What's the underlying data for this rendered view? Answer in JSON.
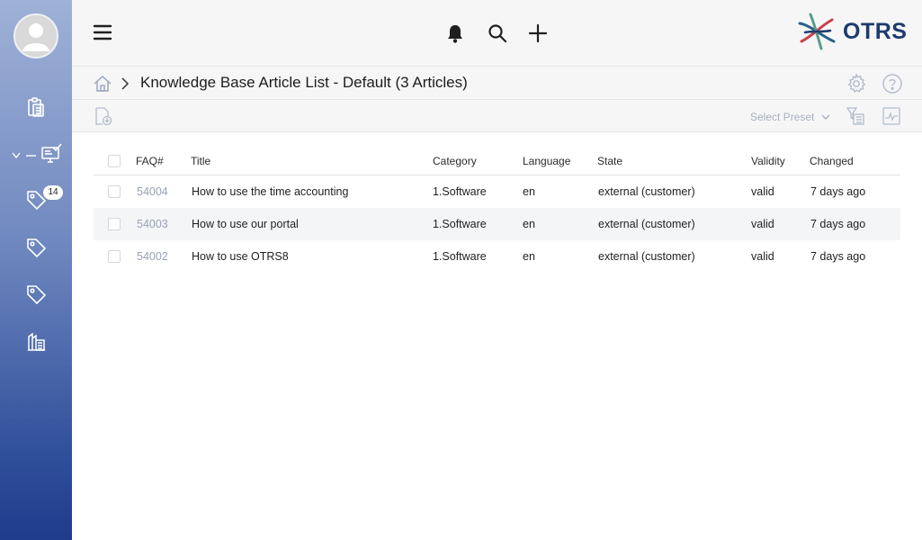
{
  "brand": {
    "name": "OTRS",
    "accent": "#1f3b8c"
  },
  "sidebar": {
    "items": [
      {
        "icon": "clipboard-icon"
      },
      {
        "icon": "agent-dashboard-icon"
      },
      {
        "icon": "tag-icon",
        "badge": "14"
      },
      {
        "icon": "tag-icon"
      },
      {
        "icon": "tag-icon"
      },
      {
        "icon": "reports-icon"
      }
    ]
  },
  "topbar": {
    "icons": [
      "menu-icon",
      "bell-icon",
      "search-icon",
      "plus-icon"
    ]
  },
  "breadcrumb": {
    "title": "Knowledge Base Article List - Default (3 Articles)"
  },
  "toolbar": {
    "preset_label": "Select Preset"
  },
  "table": {
    "columns": [
      "FAQ#",
      "Title",
      "Category",
      "Language",
      "State",
      "Validity",
      "Changed"
    ],
    "rows": [
      {
        "id": "54004",
        "title": "How to use the time accounting",
        "category": "1.Software",
        "language": "en",
        "state": "external (customer)",
        "validity": "valid",
        "changed": "7 days ago"
      },
      {
        "id": "54003",
        "title": "How to use our portal",
        "category": "1.Software",
        "language": "en",
        "state": "external (customer)",
        "validity": "valid",
        "changed": "7 days ago"
      },
      {
        "id": "54002",
        "title": "How to use OTRS8",
        "category": "1.Software",
        "language": "en",
        "state": "external (customer)",
        "validity": "valid",
        "changed": "7 days ago"
      }
    ]
  }
}
